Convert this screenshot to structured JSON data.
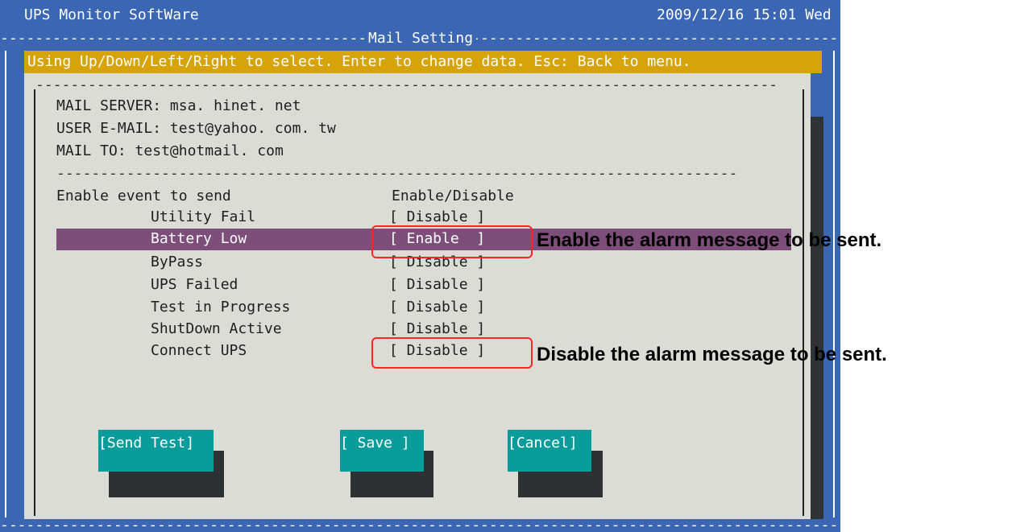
{
  "header": {
    "app_title": "UPS Monitor SoftWare",
    "datetime": "2009/12/16 15:01 Wed",
    "screen_title": "Mail Setting"
  },
  "info_bar": {
    "text": "Using Up/Down/Left/Right to select. Enter to change data. Esc: Back to menu."
  },
  "mail": {
    "server_label": "MAIL SERVER:",
    "server_value": "msa. hinet. net",
    "user_label": "USER E-MAIL:",
    "user_value": "test@yahoo. com. tw",
    "to_label": "MAIL TO:",
    "to_value": "test@hotmail. com"
  },
  "events": {
    "header_left": "Enable event to send",
    "header_right": "Enable/Disable",
    "rows": [
      {
        "label": "Utility Fail",
        "state": "[ Disable ]"
      },
      {
        "label": "Battery Low",
        "state": "[ Enable  ]"
      },
      {
        "label": "ByPass",
        "state": "[ Disable ]"
      },
      {
        "label": "UPS Failed",
        "state": "[ Disable ]"
      },
      {
        "label": "Test in Progress",
        "state": "[ Disable ]"
      },
      {
        "label": "ShutDown Active",
        "state": "[ Disable ]"
      },
      {
        "label": "Connect UPS",
        "state": "[ Disable ]"
      }
    ]
  },
  "buttons": {
    "send_test": "[Send Test]",
    "save": "[ Save ]",
    "cancel": "[Cancel]"
  },
  "annotations": {
    "enable_note": "Enable the alarm message to be sent.",
    "disable_note": "Disable the alarm message to be sent."
  },
  "colors": {
    "terminal_bg": "#3a66b4",
    "info_bar": "#d6a308",
    "panel": "#dcdcd6",
    "selected_row": "#7d4e7a",
    "button": "#0a9b9b",
    "highlight_box": "#ff2525"
  }
}
